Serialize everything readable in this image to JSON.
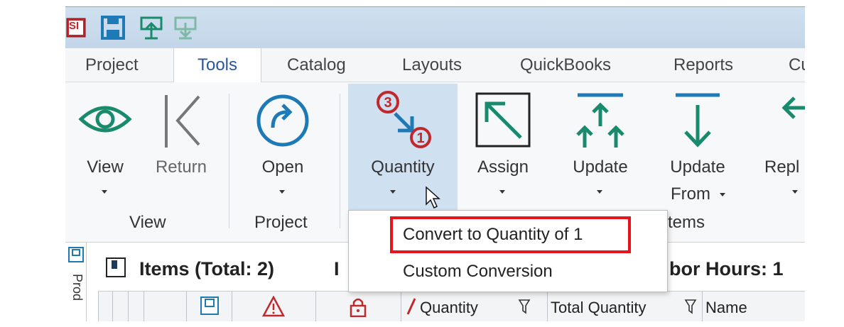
{
  "app": {
    "logo_text": "SI"
  },
  "tabs": [
    {
      "label": "Project"
    },
    {
      "label": "Tools",
      "active": true
    },
    {
      "label": "Catalog"
    },
    {
      "label": "Layouts"
    },
    {
      "label": "QuickBooks"
    },
    {
      "label": "Reports"
    },
    {
      "label": "Cu"
    }
  ],
  "ribbon": {
    "view": {
      "label": "View",
      "icon": "eye-icon"
    },
    "return": {
      "label": "Return",
      "icon": "return-icon",
      "disabled": true
    },
    "open": {
      "label": "Open",
      "icon": "open-redo-icon"
    },
    "quantity": {
      "label": "Quantity",
      "icon": "quantity-convert-icon",
      "badge_top": "3",
      "badge_bottom": "1"
    },
    "assign": {
      "label": "Assign",
      "icon": "assign-arrow-icon"
    },
    "update": {
      "label": "Update",
      "icon": "update-arrows-icon"
    },
    "update_from": {
      "label_line1": "Update",
      "label_line2": "From",
      "icon": "update-from-icon"
    },
    "replace": {
      "label": "Repl",
      "icon": "replace-icon"
    },
    "groups": {
      "view": "View",
      "project": "Project",
      "items": "tems"
    }
  },
  "dropdown": {
    "items": [
      {
        "label": "Convert to Quantity of 1"
      },
      {
        "label": "Custom Conversion"
      }
    ]
  },
  "items_panel": {
    "title": "Items (Total: 2)",
    "title_fragment": "I",
    "labor": "bor Hours: 1",
    "side_tab": "Prod"
  },
  "grid": {
    "columns": [
      {
        "label": "Quantity"
      },
      {
        "label": "Total Quantity"
      },
      {
        "label": "Name"
      }
    ]
  },
  "colors": {
    "accent_green": "#1a8a6d",
    "accent_blue": "#1e79b7",
    "badge_red": "#c0282d",
    "annotation_red": "#e8141c"
  }
}
